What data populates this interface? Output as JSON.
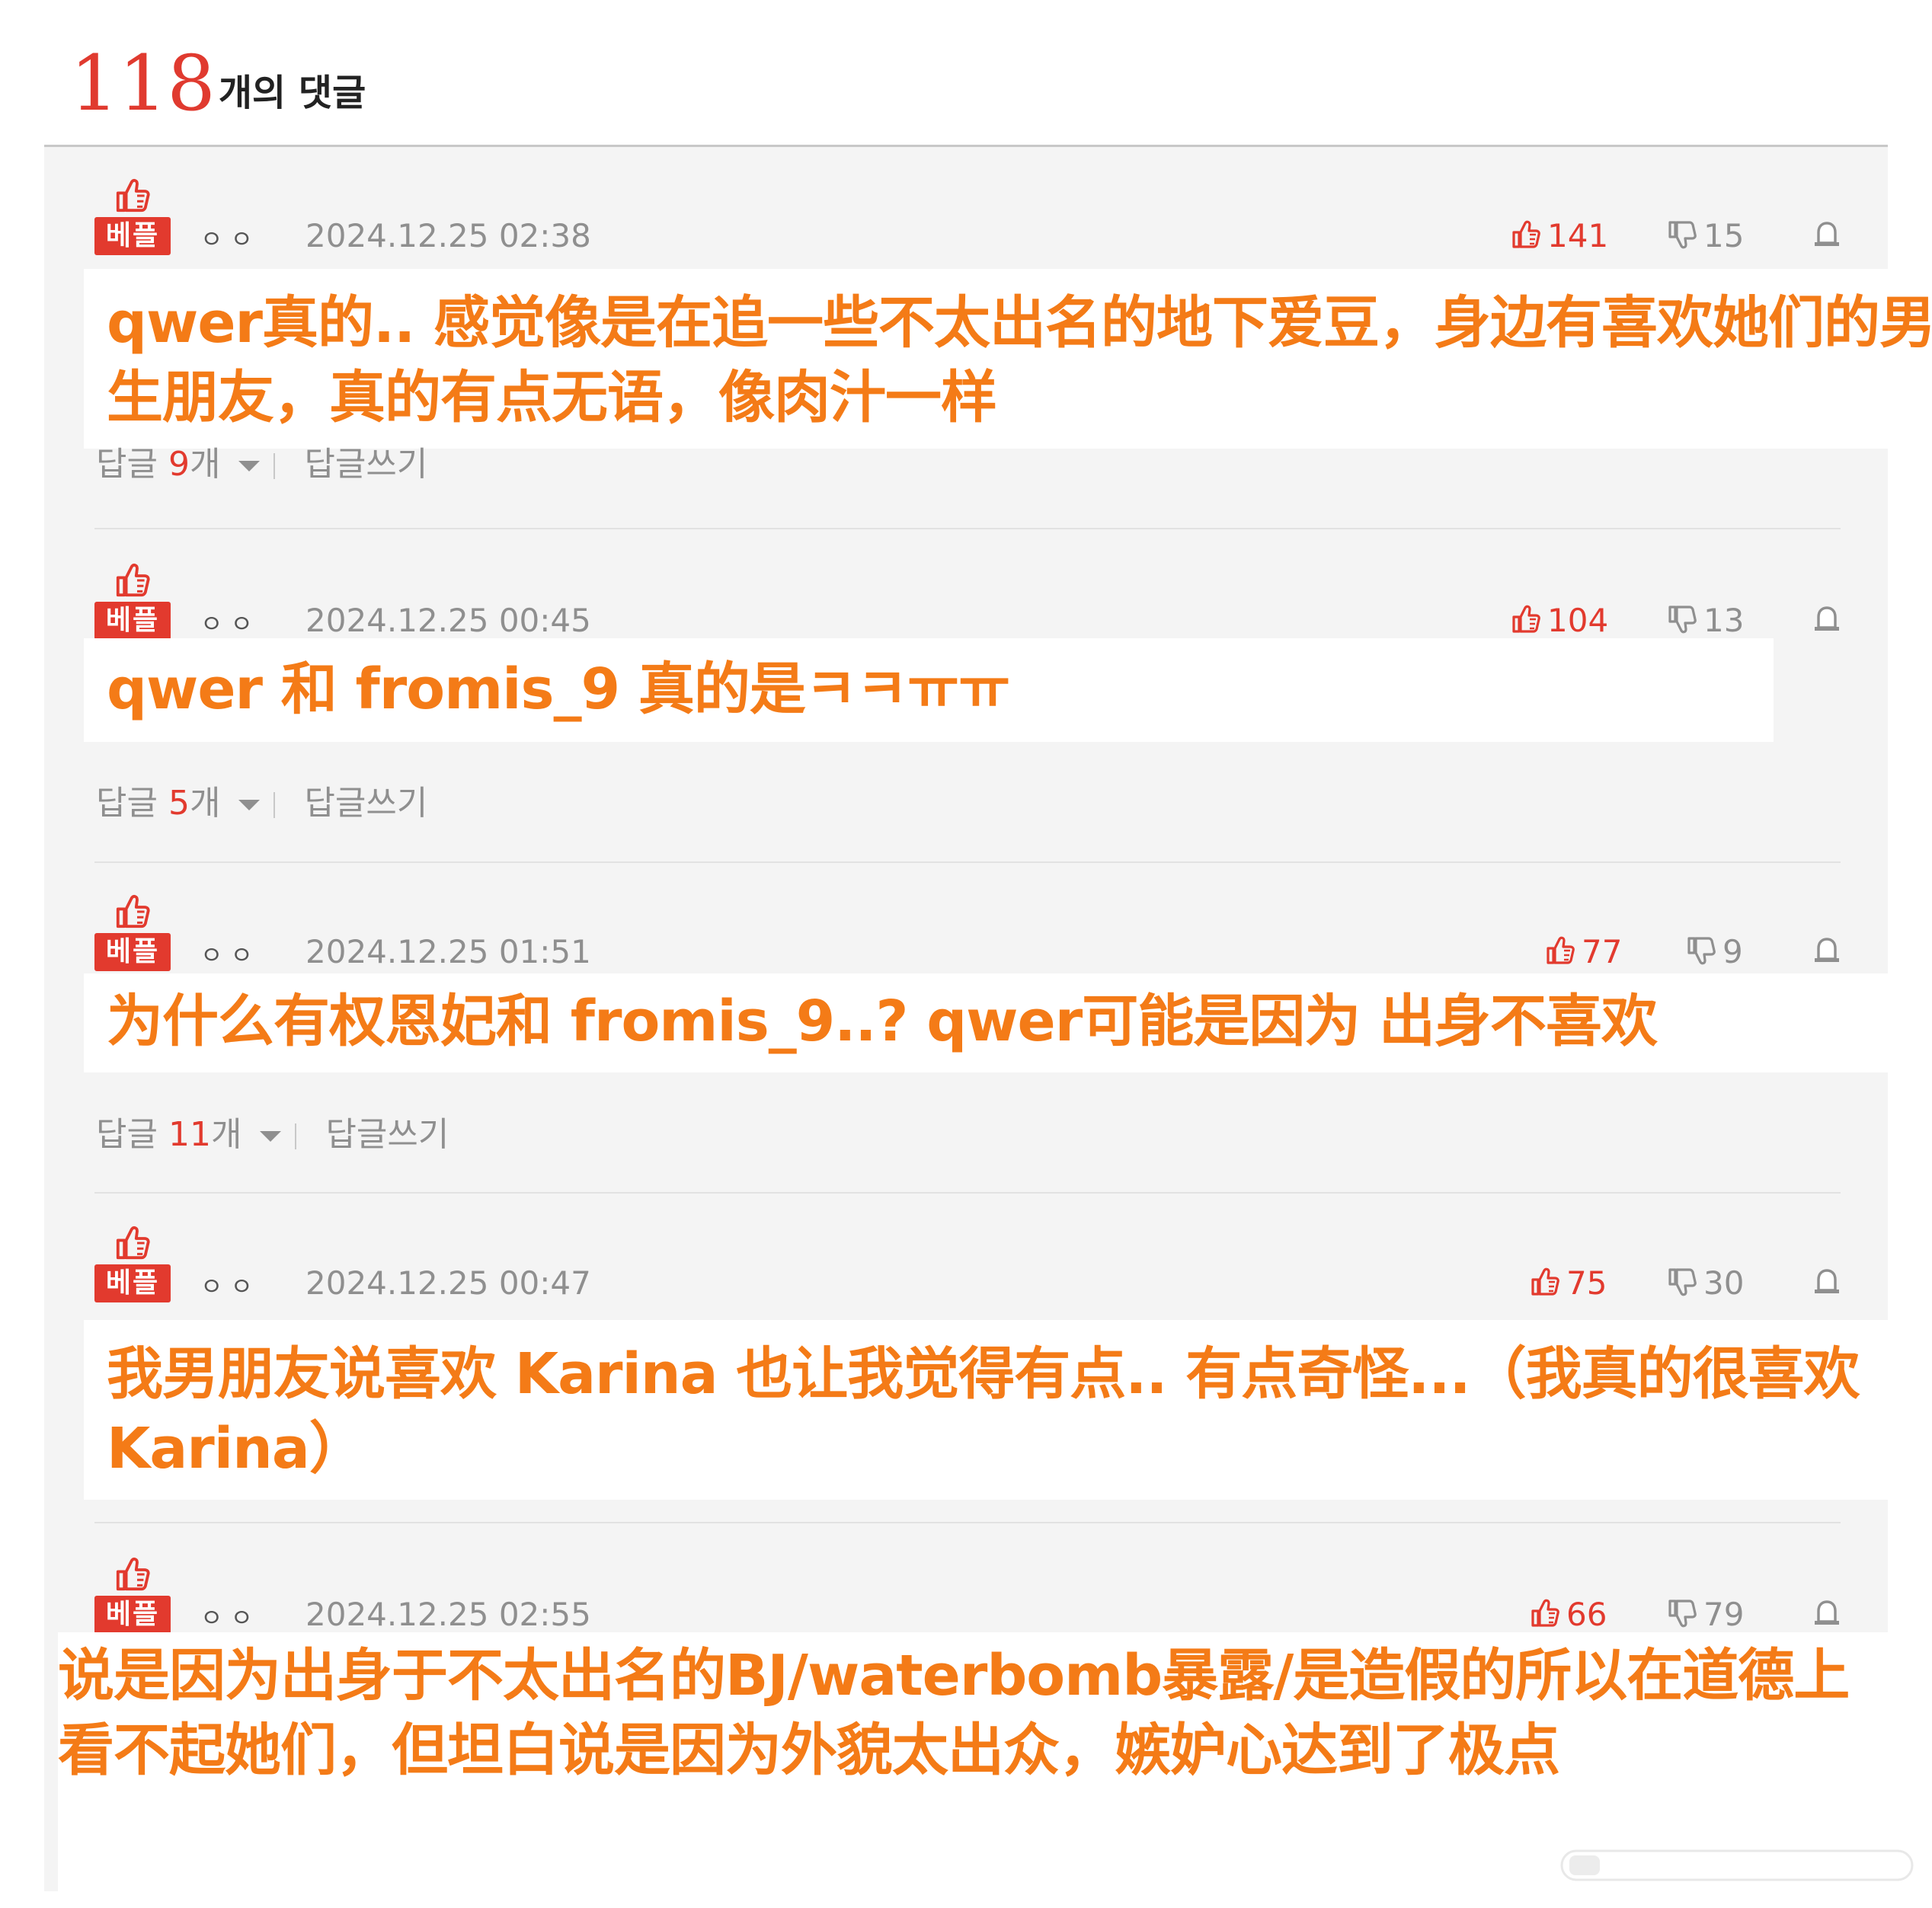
{
  "header": {
    "count": "118",
    "label": "개의 댓글"
  },
  "badge_label": "베플",
  "reply_prefix": "답글",
  "reply_suffix": "개",
  "write_reply": "답글쓰기",
  "colors": {
    "accent_red": "#e23a2e",
    "overlay_orange": "#f47b17"
  },
  "comments": [
    {
      "author": "ㅇㅇ",
      "date": "2024.12.25 02:38",
      "up": "141",
      "down": "15",
      "replies": "9",
      "text": "qwer真的.. 感觉像是在追一些不太出名的地下爱豆，身边有喜欢她们的男生朋友，真的有点无语，像肉汁一样"
    },
    {
      "author": "ㅇㅇ",
      "date": "2024.12.25 00:45",
      "up": "104",
      "down": "13",
      "replies": "5",
      "text": "qwer 和 fromis_9 真的是ㅋㅋㅠㅠ"
    },
    {
      "author": "ㅇㅇ",
      "date": "2024.12.25 01:51",
      "up": "77",
      "down": "9",
      "replies": "11",
      "text": "为什么有权恩妃和 fromis_9..? qwer可能是因为 出身不喜欢"
    },
    {
      "author": "ㅇㅇ",
      "date": "2024.12.25 00:47",
      "up": "75",
      "down": "30",
      "replies": "",
      "text": "我男朋友说喜欢 Karina 也让我觉得有点.. 有点奇怪...（我真的很喜欢 Karina）"
    },
    {
      "author": "ㅇㅇ",
      "date": "2024.12.25 02:55",
      "up": "66",
      "down": "79",
      "replies": "",
      "text": "说是因为出身于不太出名的BJ/waterbomb暴露/是造假的所以在道德上看不起她们，但坦白说是因为外貌太出众，嫉妒心达到了极点"
    }
  ]
}
